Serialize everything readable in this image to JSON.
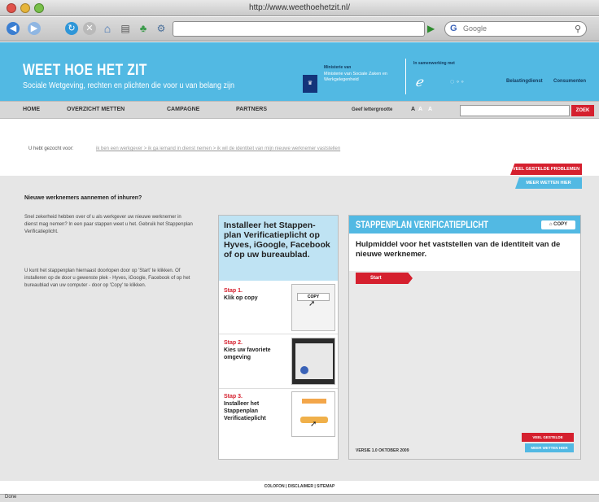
{
  "window": {
    "title": "http://www.weethoehetzit.nl/"
  },
  "toolbar": {
    "search_placeholder": "Google",
    "search_engine_label": "G"
  },
  "header": {
    "title": "WEET HOE HET ZIT",
    "subtitle": "Sociale Wetgeving, rechten en plichten die voor u van belang zijn",
    "gov_label": "Ministerie van",
    "gov_name": "Ministerie van Sociale Zaken en Werkgelegenheid",
    "partners_label": "In samenwerking met",
    "partner1": "Belastingdienst",
    "partner2": "Consumenten"
  },
  "nav": {
    "items": [
      "HOME",
      "OVERZICHT METTEN",
      "CAMPAGNE",
      "PARTNERS"
    ],
    "size_label": "Geef lettergrootte",
    "size_options": [
      "A",
      "A",
      "A"
    ],
    "search_button": "ZOEK"
  },
  "breadcrumb": {
    "label": "U hebt gezocht voor:",
    "path": "ik ben een werkgever > ik ga iemand in dienst nemen > ik wil de identiteit van mijn nieuwe werknemer vaststellen"
  },
  "ribbons": {
    "red": "VEEL GESTELDE PROBLEMEN",
    "blue": "MEER WETTEN HIER"
  },
  "intro": {
    "heading": "Nieuwe werknemers aannemen of inhuren?",
    "para1": "Snel zekerheid hebben over of u als werkgever uw nieuwe werknemer in dienst mag nemen? In een paar stappen weet u het. Gebruik het Stappenplan Verificatieplicht.",
    "para2": "U kunt het stappenplan hiernaast doorlopen door op 'Start' te klikken. Of installeren op de door u gewenste plek - Hyves, iGoogle, Facebook of op het bureaublad van uw computer - door op 'Copy' te klikken."
  },
  "steps": {
    "heading": "Installeer het Stappen-plan Verificatieplicht op Hyves, iGoogle, Facebook of op uw bureaublad.",
    "items": [
      {
        "num": "Stap 1.",
        "text": "Klik op copy"
      },
      {
        "num": "Stap 2.",
        "text": "Kies uw favoriete omgeving"
      },
      {
        "num": "Stap 3.",
        "text": "Installeer het Stappenplan Verificatieplicht"
      }
    ],
    "copy_label": "COPY"
  },
  "plan": {
    "title": "STAPPENPLAN VERIFICATIEPLICHT",
    "copy_label": "COPY",
    "description": "Hulpmiddel voor het vaststellen van de identiteit van de nieuwe werknemer.",
    "start_label": "Start",
    "version": "VERSIE 1.0 OKTOBER 2009",
    "rib_red": "VEEL GESTELDE PROBLEMEN",
    "rib_blue": "MEER WETTEN HIER"
  },
  "footer": {
    "links": "COLOFON  |  DISCLAIMER  |  SITEMAP"
  },
  "status": {
    "text": "Done"
  },
  "colors": {
    "accent_blue": "#52b9e3",
    "accent_red": "#d5202e",
    "light_blue": "#bfe3f3"
  }
}
